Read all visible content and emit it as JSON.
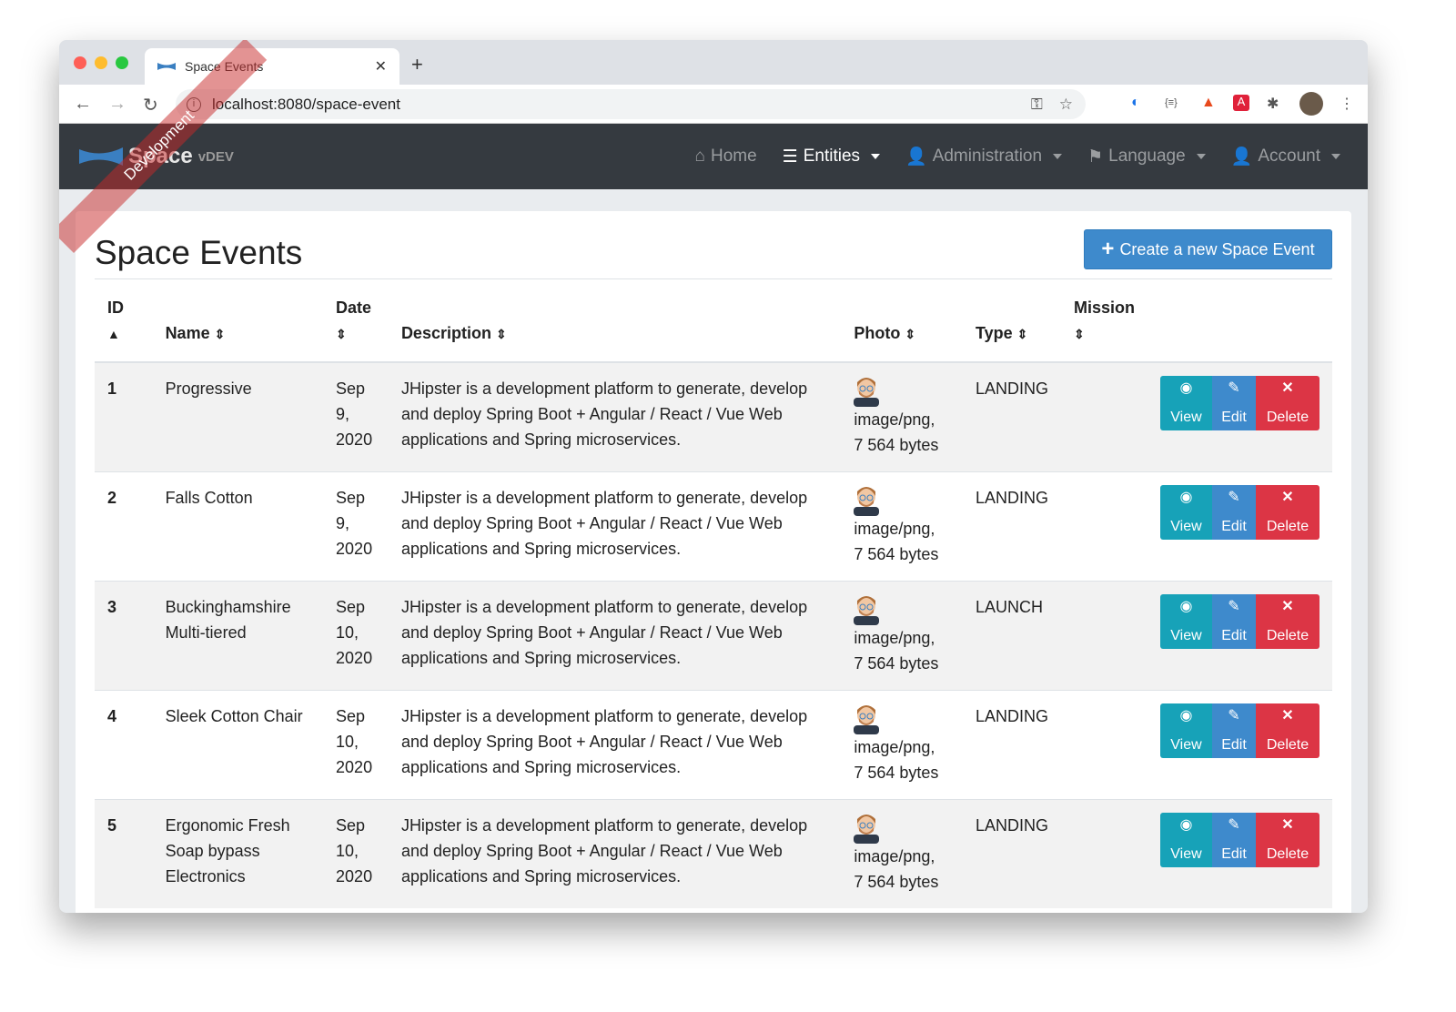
{
  "browser": {
    "tab_title": "Space Events",
    "url": "localhost:8080/space-event"
  },
  "navbar": {
    "brand": "Space",
    "version": "vDEV",
    "ribbon": "Development",
    "items": [
      {
        "label": "Home"
      },
      {
        "label": "Entities"
      },
      {
        "label": "Administration"
      },
      {
        "label": "Language"
      },
      {
        "label": "Account"
      }
    ]
  },
  "page": {
    "title": "Space Events",
    "create_label": "Create a new Space Event"
  },
  "table": {
    "headers": {
      "id": "ID",
      "name": "Name",
      "date": "Date",
      "description": "Description",
      "photo": "Photo",
      "type": "Type",
      "mission": "Mission"
    },
    "actions": {
      "view": "View",
      "edit": "Edit",
      "delete": "Delete"
    },
    "rows": [
      {
        "id": "1",
        "name": "Progressive",
        "date": "Sep 9, 2020",
        "description": "JHipster is a development platform to generate, develop and deploy Spring Boot + Angular / React / Vue Web applications and Spring microservices.",
        "photo_type": "image/png,",
        "photo_size": "7 564 bytes",
        "type": "LANDING",
        "mission": ""
      },
      {
        "id": "2",
        "name": "Falls Cotton",
        "date": "Sep 9, 2020",
        "description": "JHipster is a development platform to generate, develop and deploy Spring Boot + Angular / React / Vue Web applications and Spring microservices.",
        "photo_type": "image/png,",
        "photo_size": "7 564 bytes",
        "type": "LANDING",
        "mission": ""
      },
      {
        "id": "3",
        "name": "Buckinghamshire Multi-tiered",
        "date": "Sep 10, 2020",
        "description": "JHipster is a development platform to generate, develop and deploy Spring Boot + Angular / React / Vue Web applications and Spring microservices.",
        "photo_type": "image/png,",
        "photo_size": "7 564 bytes",
        "type": "LAUNCH",
        "mission": ""
      },
      {
        "id": "4",
        "name": "Sleek Cotton Chair",
        "date": "Sep 10, 2020",
        "description": "JHipster is a development platform to generate, develop and deploy Spring Boot + Angular / React / Vue Web applications and Spring microservices.",
        "photo_type": "image/png,",
        "photo_size": "7 564 bytes",
        "type": "LANDING",
        "mission": ""
      },
      {
        "id": "5",
        "name": "Ergonomic Fresh Soap bypass Electronics",
        "date": "Sep 10, 2020",
        "description": "JHipster is a development platform to generate, develop and deploy Spring Boot + Angular / React / Vue Web applications and Spring microservices.",
        "photo_type": "image/png,",
        "photo_size": "7 564 bytes",
        "type": "LANDING",
        "mission": ""
      }
    ]
  }
}
